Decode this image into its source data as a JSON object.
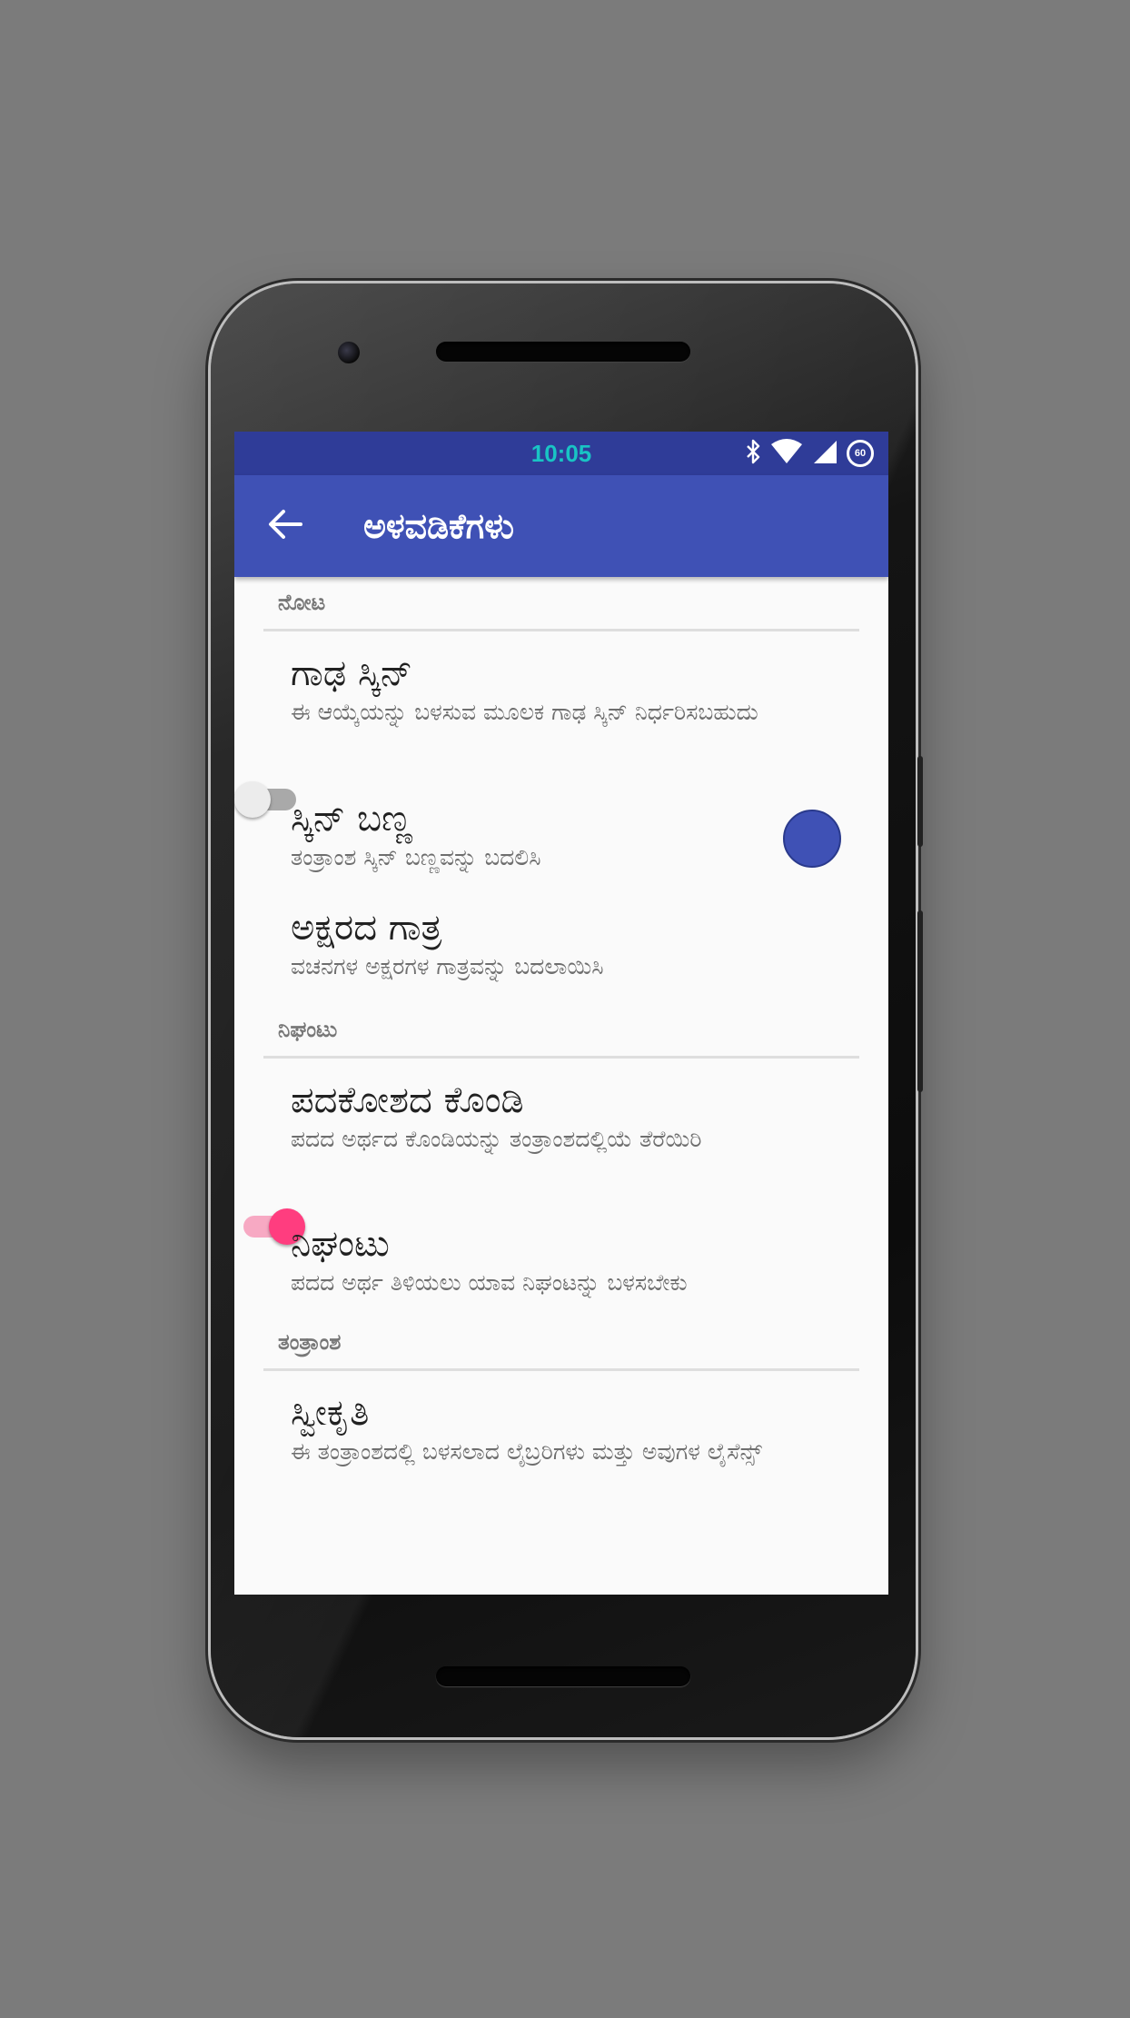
{
  "status_bar": {
    "time": "10:05",
    "battery_label": "60",
    "icons": [
      "bluetooth-icon",
      "wifi-icon",
      "cell-signal-icon",
      "battery-saver-icon"
    ],
    "time_color": "#19c4c4"
  },
  "toolbar": {
    "title": "ಅಳವಡಿಕೆಗಳು",
    "back_icon": "arrow-back-icon",
    "color": "#3f51b5"
  },
  "categories": [
    {
      "label": "ನೋಟ",
      "items": [
        {
          "title": "ಗಾಢ ಸ್ಕಿನ್",
          "summary": "ಈ ಆಯ್ಕೆಯನ್ನು ಬಳಸುವ ಮೂಲಕ ಗಾಢ ಸ್ಕಿನ್ ನಿರ್ಧರಿಸಬಹುದು",
          "widget": "switch",
          "checked": false
        },
        {
          "title": "ಸ್ಕಿನ್ ಬಣ್ಣ",
          "summary": "ತಂತ್ರಾಂಶ ಸ್ಕಿನ್ ಬಣ್ಣವನ್ನು ಬದಲಿಸಿ",
          "widget": "color",
          "color": "#3f51b5"
        },
        {
          "title": "ಅಕ್ಷರದ ಗಾತ್ರ",
          "summary": "ವಚನಗಳ ಅಕ್ಷರಗಳ ಗಾತ್ರವನ್ನು ಬದಲಾಯಿಸಿ",
          "widget": "none"
        }
      ]
    },
    {
      "label": "ನಿಘಂಟು",
      "items": [
        {
          "title": "ಪದಕೋಶದ ಕೊಂಡಿ",
          "summary": "ಪದದ ಅರ್ಥದ ಕೊಂಡಿಯನ್ನು ತಂತ್ರಾಂಶದಲ್ಲಿಯೆ ತೆರೆಯಿರಿ",
          "widget": "switch",
          "checked": true
        },
        {
          "title": "ನಿಘಂಟು",
          "summary": "ಪದದ ಅರ್ಥ ತಿಳಿಯಲು ಯಾವ ನಿಘಂಟನ್ನು ಬಳಸಬೇಕು",
          "widget": "none"
        }
      ]
    },
    {
      "label": "ತಂತ್ರಾಂಶ",
      "items": [
        {
          "title": "ಸ್ವೀಕೃತಿ",
          "summary": "ಈ ತಂತ್ರಾಂಶದಲ್ಲಿ ಬಳಸಲಾದ ಲೈಬ್ರರಿಗಳು ಮತ್ತು ಅವುಗಳ ಲೈಸೆನ್ಸ್",
          "widget": "none"
        }
      ]
    }
  ]
}
